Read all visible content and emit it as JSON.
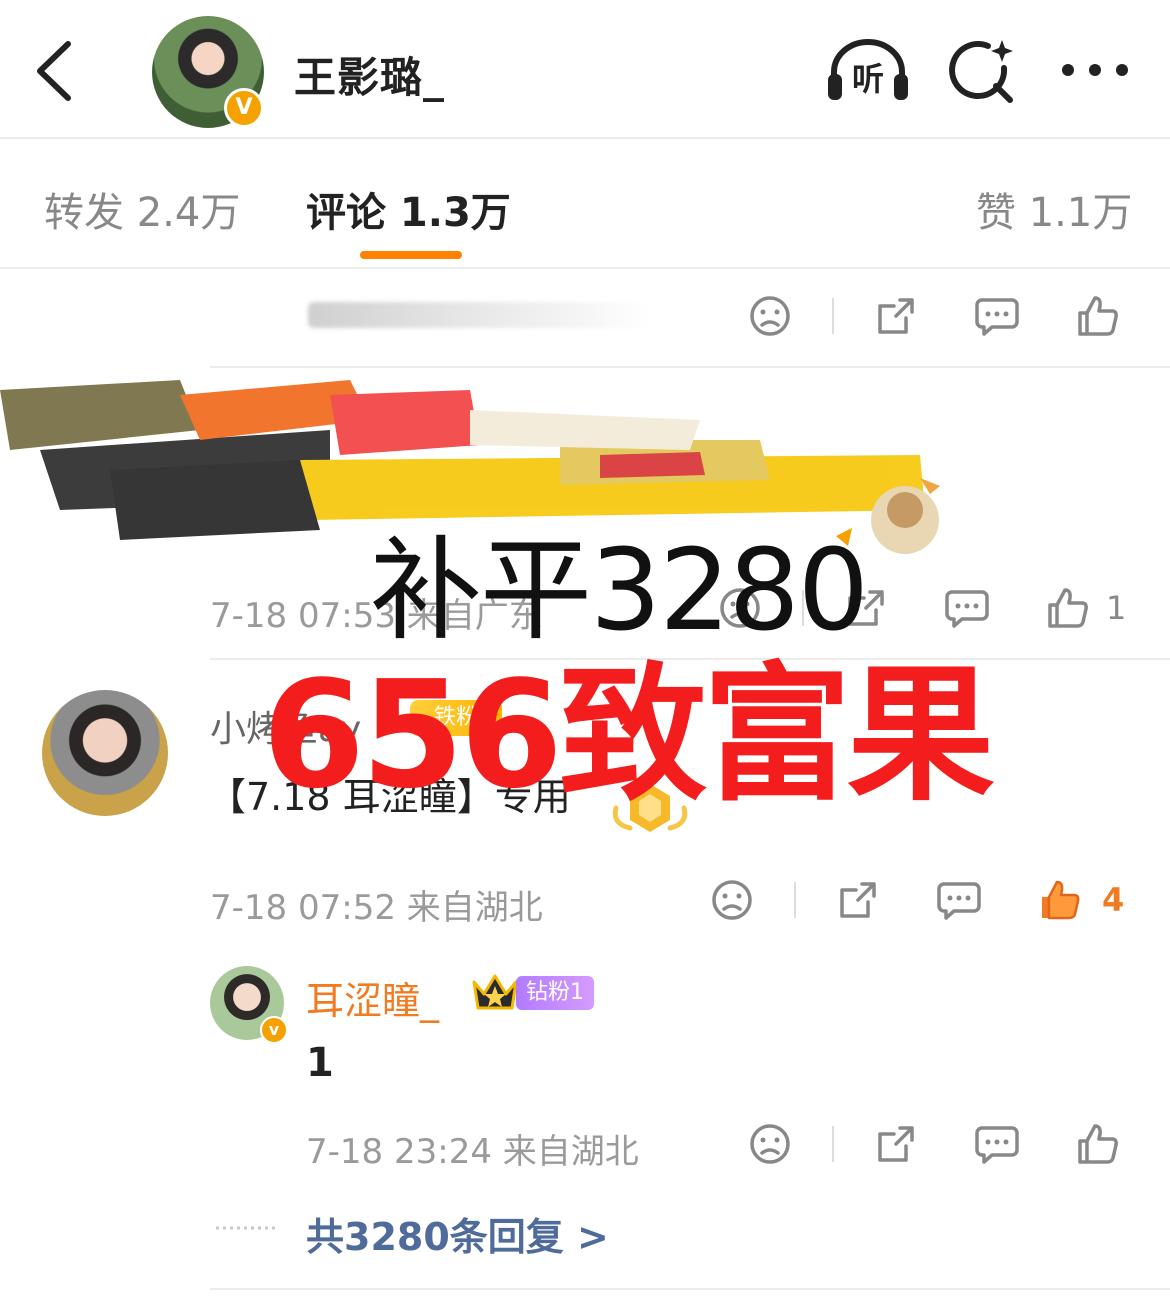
{
  "header": {
    "title": "王影璐_",
    "back_icon": "chevron-left-icon",
    "verified_badge": "V",
    "listen_label": "听",
    "search_icon": "search-sparkle-icon",
    "more_icon": "more-dots-icon"
  },
  "tabs": [
    {
      "label": "转发 2.4万",
      "active": false
    },
    {
      "label": "评论 1.3万",
      "active": true
    },
    {
      "label": "赞 1.1万",
      "active": false
    }
  ],
  "colors": {
    "accent": "#ff8200",
    "overlay_red": "#f41d1d",
    "link_blue": "#4f6b9a",
    "reply_name": "#f07b22",
    "like_active": "#f07b22"
  },
  "overlay": {
    "line1": "补平3280",
    "line2": "656致富果"
  },
  "rows": {
    "row1": {
      "meta": ""
    },
    "row2": {
      "meta": "7-18 07:53 来自广东",
      "like_count": "1"
    }
  },
  "comment": {
    "name": "小烤鱼ay",
    "fan_badge": "铁粉",
    "text": "【7.18 耳涩瞳】专用",
    "meta": "7-18 07:52 来自湖北",
    "like_count": "4"
  },
  "reply": {
    "name": "耳涩瞳_",
    "badge": "钻粉1",
    "verified_badge": "v",
    "text": "1",
    "meta": "7-18 23:24 来自湖北"
  },
  "replies_link": "共3280条回复 >"
}
